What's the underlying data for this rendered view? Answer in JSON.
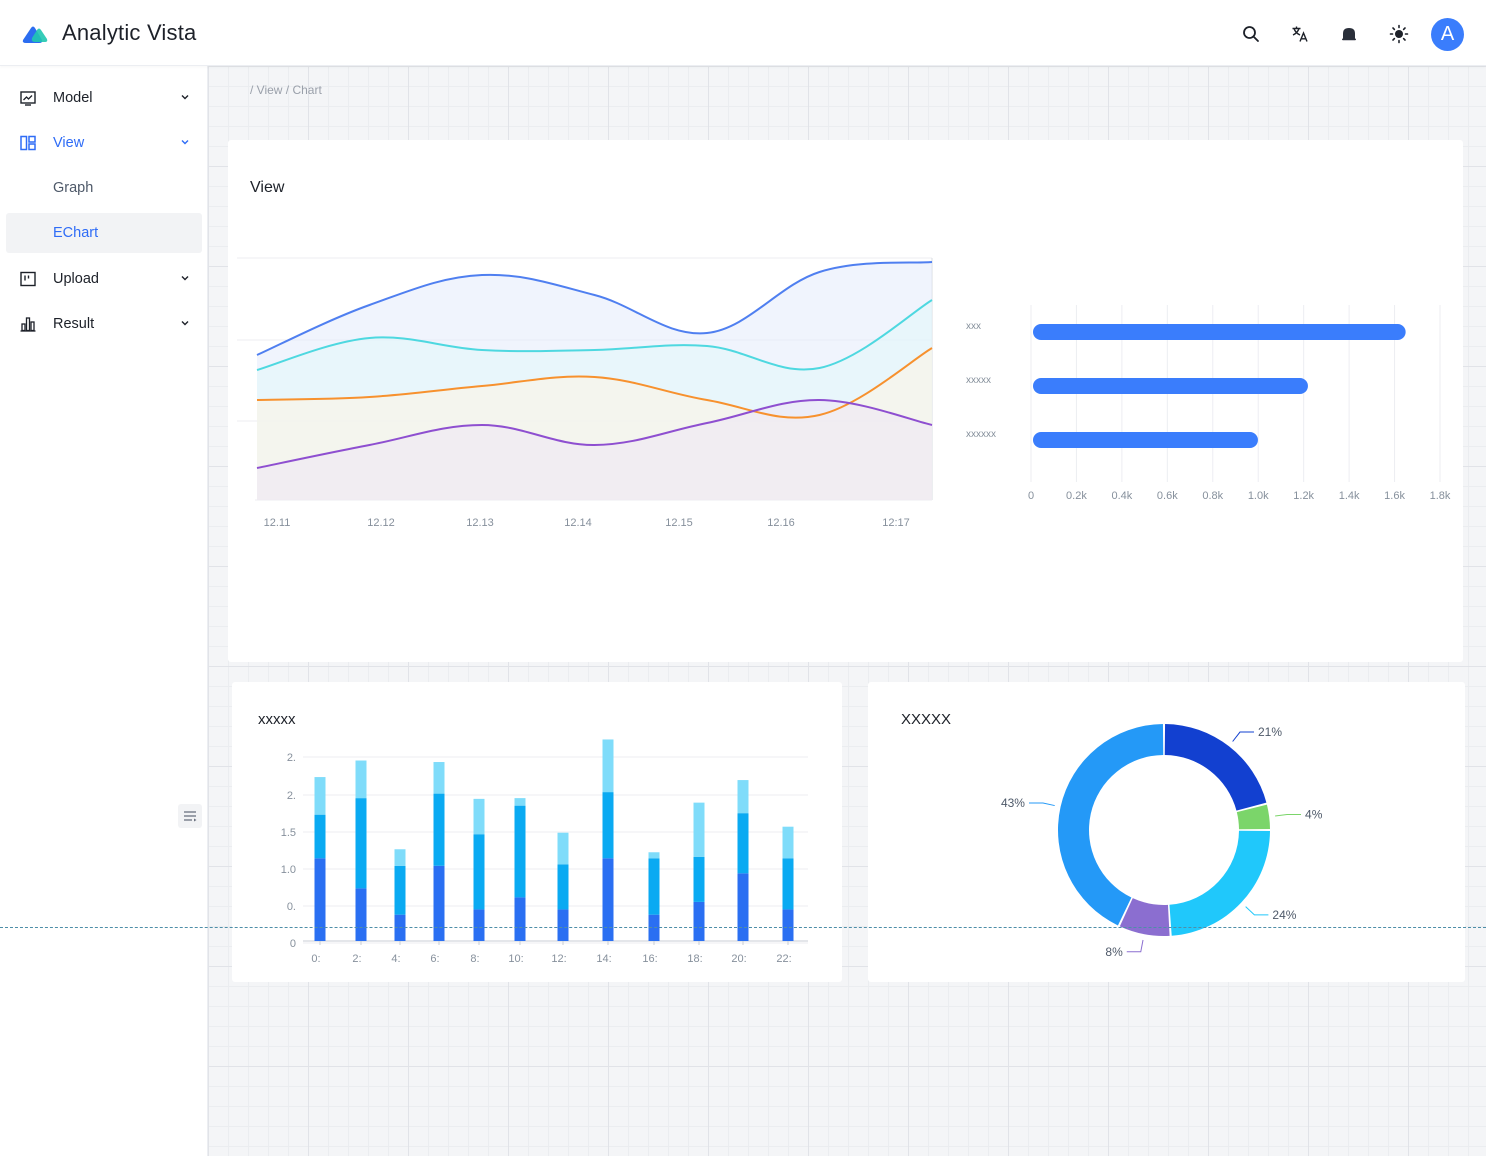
{
  "app": {
    "title": "Analytic Vista",
    "avatar_letter": "A",
    "accent": "#2f6cf6"
  },
  "topbar": {
    "icons": [
      "search-icon",
      "translate-icon",
      "notification-icon",
      "theme-icon"
    ]
  },
  "sidebar": {
    "items": [
      {
        "label": "Model",
        "icon": "model-icon",
        "expandable": true
      },
      {
        "label": "View",
        "icon": "view-icon",
        "expandable": true,
        "active": true
      },
      {
        "label": "Graph",
        "sub": true
      },
      {
        "label": "EChart",
        "sub": true,
        "selected": true
      },
      {
        "label": "Upload",
        "icon": "upload-icon",
        "expandable": true
      },
      {
        "label": "Result",
        "icon": "result-icon",
        "expandable": true
      }
    ]
  },
  "breadcrumb": "/ View / Chart",
  "view_card": {
    "title": "View"
  },
  "bar_card": {
    "title": "xxxxx"
  },
  "pie_card": {
    "title": "XXXXX"
  },
  "chart_data": [
    {
      "type": "area",
      "categories": [
        "12.11",
        "12.12",
        "12.13",
        "12.14",
        "12.15",
        "12.16",
        "12:17"
      ],
      "series": [
        {
          "color": "#4f7ff0",
          "values": [
            355,
            305,
            275,
            295,
            333,
            272,
            262
          ],
          "fill": "#e4ebfb"
        },
        {
          "color": "#4ed8e0",
          "values": [
            370,
            338,
            350,
            350,
            346,
            368,
            300
          ],
          "fill": "#e2f8fa"
        },
        {
          "color": "#f7912e",
          "values": [
            400,
            397,
            386,
            377,
            400,
            415,
            348
          ],
          "fill": "#fdf4e3"
        },
        {
          "color": "#8e4fd0",
          "values": [
            468,
            445,
            425,
            445,
            423,
            400,
            425
          ],
          "fill": "#eee6f6"
        }
      ]
    },
    {
      "type": "bar",
      "orientation": "horizontal",
      "categories": [
        "xxx",
        "xxxxx",
        "xxxxxx"
      ],
      "values": [
        1640,
        1210,
        990
      ],
      "color": "#3a7dfc",
      "xticks": [
        "0",
        "0.2k",
        "0.4k",
        "0.6k",
        "0.8k",
        "1.0k",
        "1.2k",
        "1.4k",
        "1.6k",
        "1.8k"
      ],
      "xlim": [
        0,
        1800
      ]
    },
    {
      "type": "bar",
      "stacked": true,
      "categories": [
        "0:",
        "2:",
        "4:",
        "6:",
        "8:",
        "10:",
        "12:",
        "14:",
        "16:",
        "18:",
        "20:",
        "22:"
      ],
      "yticks": [
        "0",
        "0.",
        "1.0",
        "1.5",
        "2.",
        "2."
      ],
      "ylim": [
        0,
        2.5
      ],
      "series": [
        {
          "color": "#2a6ff2",
          "values": [
            1.1,
            0.7,
            0.35,
            1.0,
            0.42,
            0.58,
            0.42,
            1.1,
            0.35,
            0.52,
            0.9,
            0.42
          ]
        },
        {
          "color": "#0aaaf2",
          "values": [
            0.58,
            1.2,
            0.65,
            0.96,
            1.0,
            1.22,
            0.6,
            0.88,
            0.75,
            0.6,
            0.8,
            0.68
          ]
        },
        {
          "color": "#7fdcfa",
          "values": [
            0.5,
            0.5,
            0.22,
            0.42,
            0.47,
            0.1,
            0.42,
            0.7,
            0.08,
            0.72,
            0.44,
            0.42
          ]
        }
      ]
    },
    {
      "type": "pie",
      "donut": true,
      "slices": [
        {
          "label": "21%",
          "value": 21,
          "color": "#1240d0"
        },
        {
          "label": "4%",
          "value": 4,
          "color": "#7bd56a"
        },
        {
          "label": "24%",
          "value": 24,
          "color": "#20c8fb"
        },
        {
          "label": "8%",
          "value": 8,
          "color": "#8b6ed0"
        },
        {
          "label": "43%",
          "value": 43,
          "color": "#2499f7"
        }
      ]
    }
  ]
}
